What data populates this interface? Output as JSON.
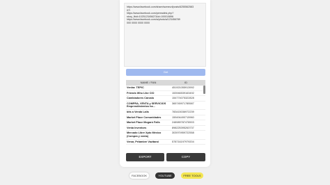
{
  "textarea": {
    "lines": [
      "https://www.facebook.com/share/someurl/posts/6255562583",
      "07/",
      "https://www.facebook.com/permalink.php?",
      "story_fbid=102512345627&id=100010896",
      "https://www.facebook.com/a/photo/a/123456789",
      "000 0000 0000 0000"
    ]
  },
  "convert_label": "Get",
  "table": {
    "headers": [
      "NAME / FAN",
      "ID"
    ],
    "rows": [
      {
        "name": "Venha: TEPIC",
        "id": "451921055913992"
      },
      {
        "name": "Friends Who Like CIO",
        "id": "153946539163492"
      },
      {
        "name": "Cambiadores Cárcala",
        "id": "154774075322828"
      },
      {
        "name": "COMPRA, VENTA y SERVICIOS Emprendimientos ha…",
        "id": "365745971785587"
      },
      {
        "name": "bits a Venda Lalis",
        "id": "783415036972239"
      },
      {
        "name": "Market Place Comunidades",
        "id": "159494490715960"
      },
      {
        "name": "Market Place Mogaró Falls",
        "id": "248989787478903"
      },
      {
        "name": "Venta Inventors",
        "id": "898225395263737"
      },
      {
        "name": "Mercado Libre Xpto México (Compra y venta)",
        "id": "303970959722558"
      },
      {
        "name": "Venar, Pelambre Vazitarai",
        "id": "578716197979204"
      }
    ]
  },
  "actions": {
    "export_label": "EXPORT",
    "copy_label": "COPY"
  },
  "footer": {
    "facebook_label": "FACEBOOK",
    "youtube_label": "YOUTUBE",
    "freetools_label": "FREE TOOLS"
  },
  "colors": {
    "convert_button": "#9fb9ef",
    "dark_button": "#3a3a3a",
    "free_tools_pill": "#f4e652"
  }
}
